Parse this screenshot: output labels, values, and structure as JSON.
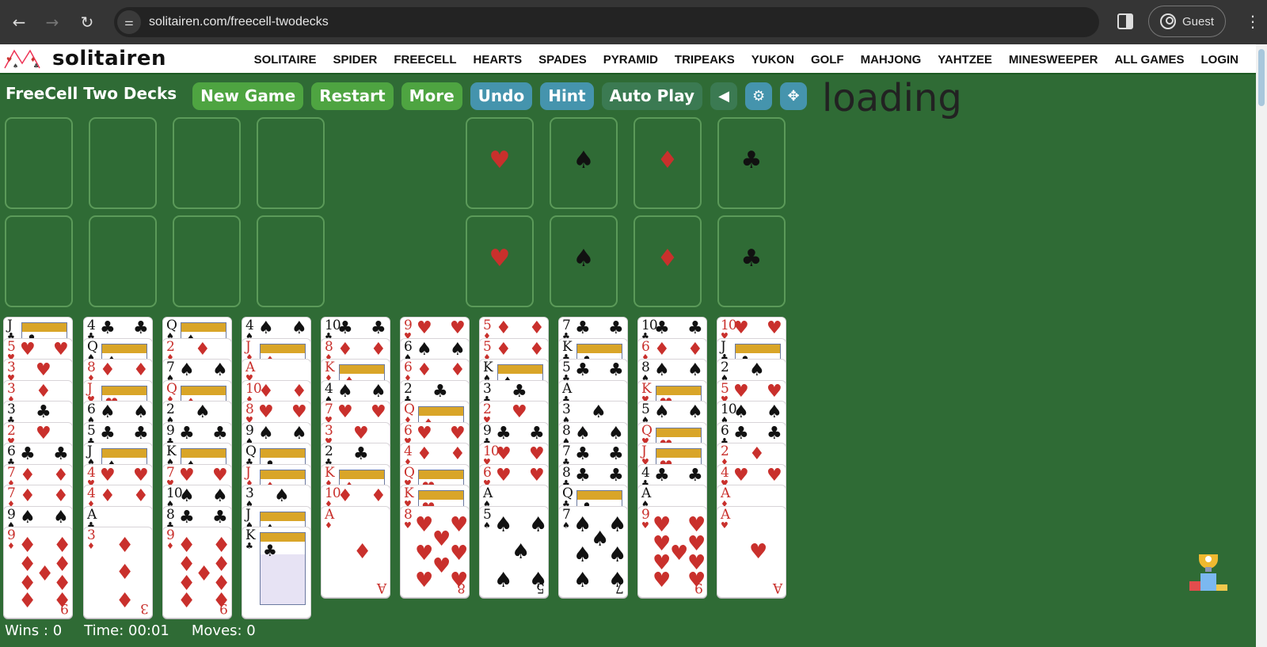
{
  "browser": {
    "url": "solitairen.com/freecell-twodecks",
    "profile_label": "Guest",
    "icons": {
      "back": "back-arrow-icon",
      "forward": "forward-arrow-icon",
      "reload": "reload-icon",
      "site_info": "tune-icon",
      "side_panel": "side-panel-icon",
      "menu": "kebab-menu-icon"
    }
  },
  "site": {
    "logo_text": "solitairen",
    "nav": [
      "SOLITAIRE",
      "SPIDER",
      "FREECELL",
      "HEARTS",
      "SPADES",
      "PYRAMID",
      "TRIPEAKS",
      "YUKON",
      "GOLF",
      "MAHJONG",
      "YAHTZEE",
      "MINESWEEPER",
      "ALL GAMES",
      "LOGIN"
    ]
  },
  "toolbar": {
    "title": "FreeCell Two Decks",
    "new_game": "New Game",
    "restart": "Restart",
    "more": "More",
    "undo": "Undo",
    "hint": "Hint",
    "auto_play": "Auto Play",
    "sound_icon": "◀",
    "settings_icon": "⚙",
    "move_icon": "✥"
  },
  "loading_text": "loading",
  "foundations": {
    "row1": [
      {
        "suit": "♥",
        "color": "red"
      },
      {
        "suit": "♠",
        "color": "blk"
      },
      {
        "suit": "♦",
        "color": "red"
      },
      {
        "suit": "♣",
        "color": "blk"
      }
    ],
    "row2": [
      {
        "suit": "♥",
        "color": "red"
      },
      {
        "suit": "♠",
        "color": "blk"
      },
      {
        "suit": "♦",
        "color": "red"
      },
      {
        "suit": "♣",
        "color": "blk"
      }
    ]
  },
  "free_cells": 8,
  "tableau": [
    [
      "J♣",
      "5♥",
      "3♥",
      "3♦",
      "3♣",
      "2♥",
      "6♣",
      "7♦",
      "7♦",
      "9♠",
      "9♦"
    ],
    [
      "4♣",
      "Q♠",
      "8♦",
      "J♥",
      "6♠",
      "5♣",
      "J♠",
      "4♥",
      "4♦",
      "A♣",
      "3♦"
    ],
    [
      "Q♠",
      "2♦",
      "7♠",
      "Q♦",
      "2♠",
      "9♣",
      "K♠",
      "7♥",
      "10♠",
      "8♣",
      "9♦"
    ],
    [
      "4♠",
      "J♦",
      "A♥",
      "10♦",
      "8♥",
      "9♠",
      "Q♣",
      "J♦",
      "3♠",
      "J♠",
      "K♣"
    ],
    [
      "10♣",
      "8♦",
      "K♦",
      "4♠",
      "7♥",
      "3♥",
      "2♣",
      "K♦",
      "10♦",
      "A♦"
    ],
    [
      "9♥",
      "6♠",
      "6♦",
      "2♣",
      "Q♦",
      "6♥",
      "4♦",
      "Q♥",
      "K♥",
      "8♥"
    ],
    [
      "5♦",
      "5♦",
      "K♠",
      "3♣",
      "2♥",
      "9♣",
      "10♥",
      "6♥",
      "A♠",
      "5♠"
    ],
    [
      "7♣",
      "K♣",
      "5♣",
      "A♣",
      "3♠",
      "8♠",
      "7♣",
      "8♣",
      "Q♣",
      "7♠"
    ],
    [
      "10♣",
      "6♦",
      "8♠",
      "K♥",
      "5♠",
      "Q♥",
      "J♥",
      "4♣",
      "A♠",
      "9♥"
    ],
    [
      "10♥",
      "J♣",
      "2♠",
      "5♥",
      "10♠",
      "6♣",
      "2♦",
      "4♥",
      "A♦",
      "A♥"
    ]
  ],
  "status": {
    "wins": "Wins : 0",
    "time": "Time: 00:01",
    "moves": "Moves: 0"
  },
  "colors": {
    "felt": "#2f6b35",
    "green_button": "#4ea441",
    "blue_button": "#4594ad",
    "red_suit": "#c9302c"
  }
}
